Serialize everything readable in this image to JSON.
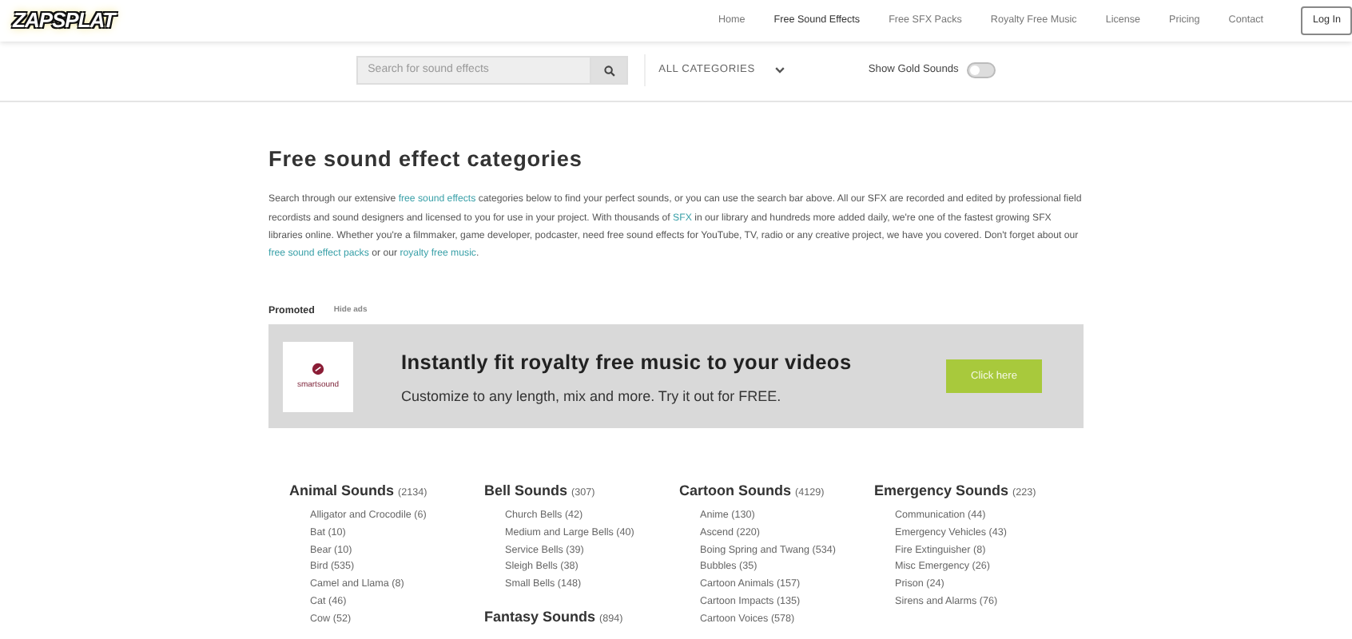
{
  "logo": {
    "text": "ZAPSPLAT"
  },
  "nav": [
    {
      "label": "Home",
      "selected": false
    },
    {
      "label": "Free Sound Effects",
      "selected": true
    },
    {
      "label": "Free SFX Packs",
      "selected": false
    },
    {
      "label": "Royalty Free Music",
      "selected": false
    },
    {
      "label": "License",
      "selected": false
    },
    {
      "label": "Pricing",
      "selected": false
    },
    {
      "label": "Contact",
      "selected": false
    }
  ],
  "login": "Log In",
  "search": {
    "placeholder": "Search for sound effects"
  },
  "category_select": "ALL CATEGORIES",
  "gold_toggle": {
    "label": "Show Gold Sounds",
    "on": false
  },
  "heading": "Free sound effect categories",
  "intro": [
    {
      "kind": "text",
      "text": "Search through our extensive "
    },
    {
      "kind": "link",
      "text": "free sound effects"
    },
    {
      "kind": "text",
      "text": " categories below to find your perfect sounds, or you can use the search bar above. All our SFX are recorded and edited by professional field recordists and sound designers and licensed to you for use in your project. With thousands of "
    },
    {
      "kind": "link",
      "text": "SFX"
    },
    {
      "kind": "text",
      "text": " in our library and hundreds more added daily, we're one of the fastest growing SFX libraries online. Whether you're a filmmaker, game developer, podcaster, need free sound effects for YouTube, TV, radio or any creative project, we have you covered. Don't forget about our "
    },
    {
      "kind": "link",
      "text": "free sound effect packs"
    },
    {
      "kind": "text",
      "text": " or our "
    },
    {
      "kind": "link",
      "text": "royalty free music"
    },
    {
      "kind": "text",
      "text": "."
    }
  ],
  "promoted": {
    "label": "Promoted",
    "hide": "Hide ads"
  },
  "ad": {
    "logo_text": "smartsound",
    "title": "Instantly fit royalty free music to your videos",
    "subtitle": "Customize to any length, mix and more. Try it out for FREE.",
    "button": "Click here"
  },
  "category_columns": [
    [
      {
        "name": "Animal Sounds",
        "count": "(2134)",
        "items": [
          "Alligator and Crocodile (6)",
          "Bat (10)",
          "Bear (10)",
          "Bird (535)",
          "Camel and Llama (8)",
          "Cat (46)",
          "Cow (52)"
        ]
      }
    ],
    [
      {
        "name": "Bell Sounds",
        "count": "(307)",
        "items": [
          "Church Bells (42)",
          "Medium and Large Bells (40)",
          "Service Bells (39)",
          "Sleigh Bells (38)",
          "Small Bells (148)"
        ]
      },
      {
        "name": "Fantasy Sounds",
        "count": "(894)"
      }
    ],
    [
      {
        "name": "Cartoon Sounds",
        "count": "(4129)",
        "items": [
          "Anime (130)",
          "Ascend (220)",
          "Boing Spring and Twang (534)",
          "Bubbles (35)",
          "Cartoon Animals (157)",
          "Cartoon Impacts (135)",
          "Cartoon Voices (578)"
        ]
      }
    ],
    [
      {
        "name": "Emergency Sounds",
        "count": "(223)",
        "items": [
          "Communication (44)",
          "Emergency Vehicles (43)",
          "Fire Extinguisher (8)",
          "Misc Emergency (26)",
          "Prison (24)",
          "Sirens and Alarms (76)"
        ]
      }
    ]
  ]
}
